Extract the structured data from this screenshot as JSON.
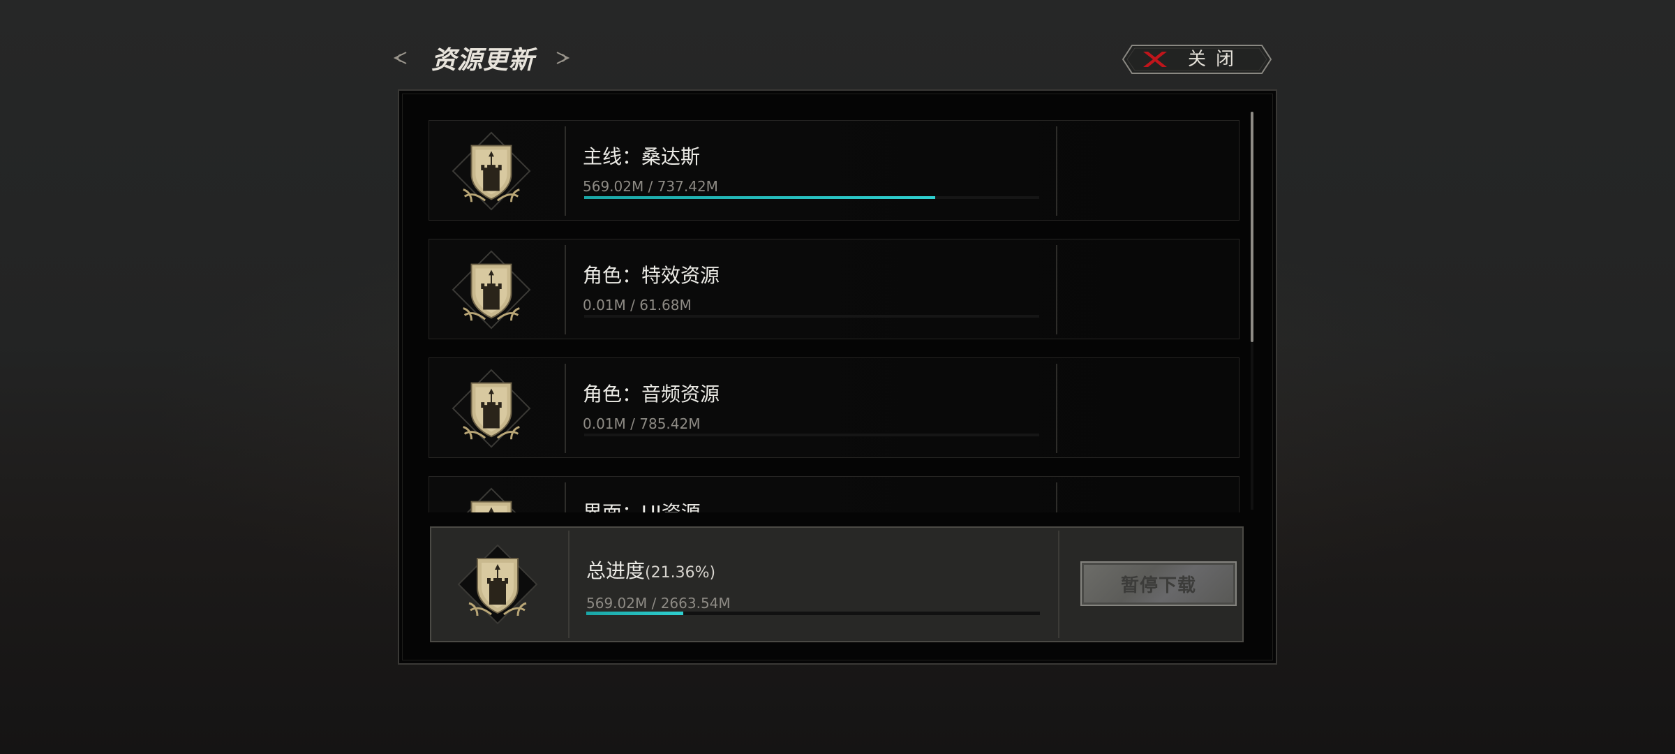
{
  "header": {
    "title": "资源更新",
    "left_ornament_icon": "ornament-left-icon",
    "right_ornament_icon": "ornament-right-icon"
  },
  "close_button": {
    "label": "关闭",
    "icon": "close-x-icon",
    "icon_color": "#c0151b"
  },
  "accent_color": "#2fd0d0",
  "resources": [
    {
      "name": "主线：桑达斯",
      "size": "569.02M / 737.42M",
      "progress": 0.7716,
      "icon": "castle-crest-icon"
    },
    {
      "name": "角色：特效资源",
      "size": "0.01M / 61.68M",
      "progress": 0.0002,
      "icon": "castle-crest-icon"
    },
    {
      "name": "角色：音频资源",
      "size": "0.01M / 785.42M",
      "progress": 0.0,
      "icon": "castle-crest-icon"
    },
    {
      "name": "界面：UI资源",
      "size": "",
      "progress": 0.0,
      "icon": "castle-crest-icon"
    }
  ],
  "total": {
    "label": "总进度",
    "percent": "(21.36%)",
    "size": "569.02M / 2663.54M",
    "progress": 0.2136,
    "icon": "castle-crest-icon"
  },
  "pause_button": {
    "label": "暂停下载",
    "state": "disabled"
  }
}
